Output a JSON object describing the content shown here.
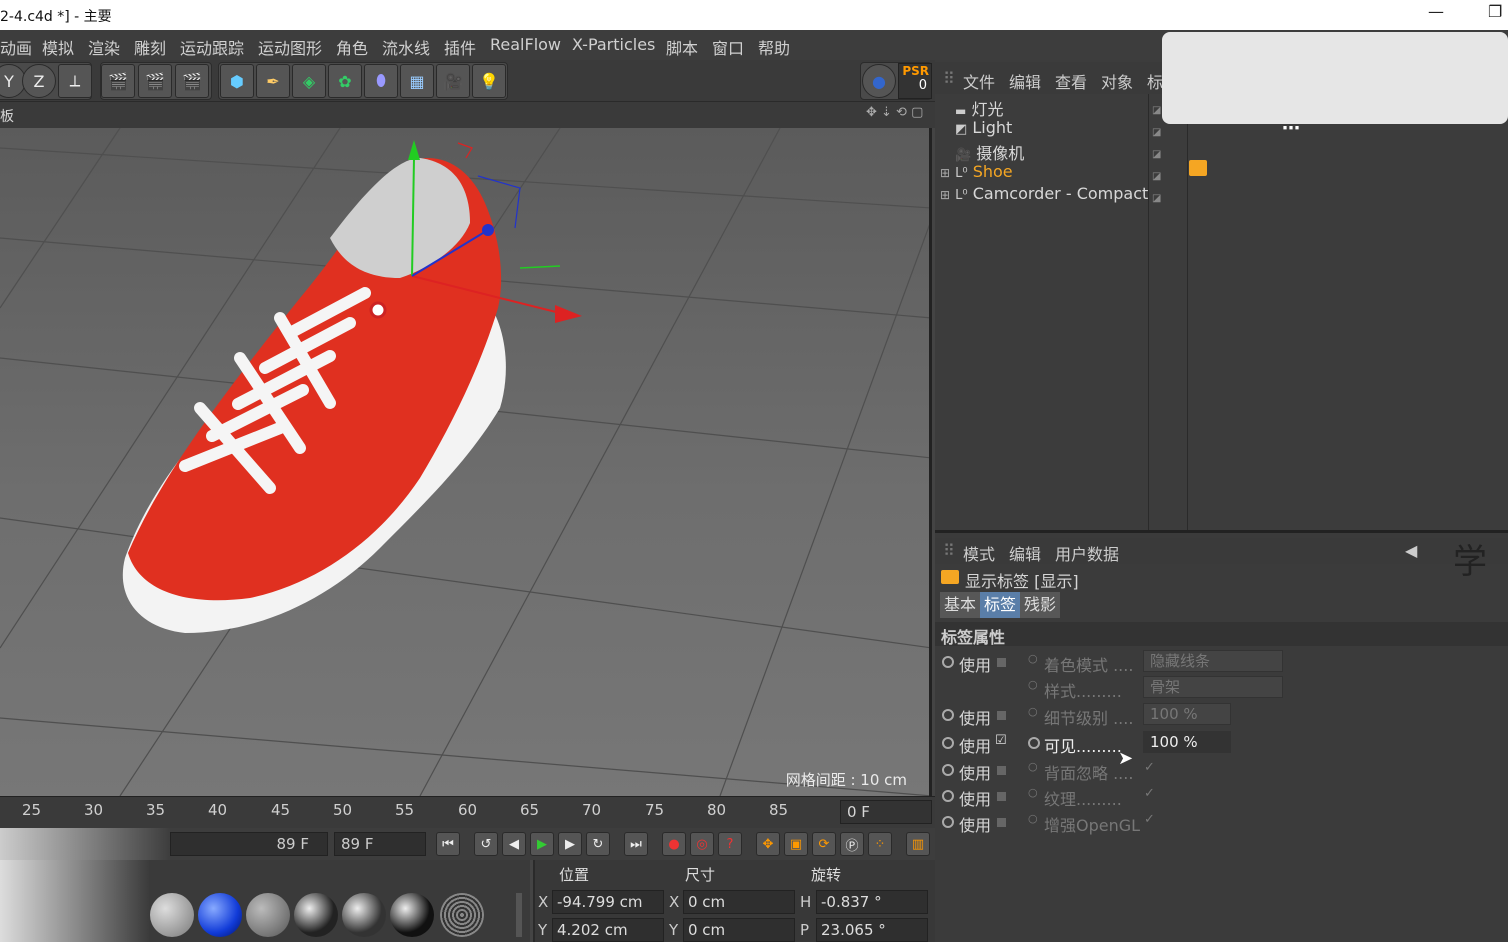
{
  "window": {
    "title": "2-4.c4d *] - 主要",
    "minimize": "—",
    "restore": "❐"
  },
  "menu": [
    "动画",
    "模拟",
    "渲染",
    "雕刻",
    "运动跟踪",
    "运动图形",
    "角色",
    "流水线",
    "插件",
    "RealFlow",
    "X-Particles",
    "脚本",
    "窗口",
    "帮助"
  ],
  "toolbar": {
    "y_label": "Y",
    "z_label": "Z",
    "psr": "PSR",
    "psr_value": "0"
  },
  "viewport": {
    "head_label": "板",
    "grid_spacing": "网格间距 : 10 cm"
  },
  "timeline": {
    "ticks": [
      "25",
      "30",
      "35",
      "40",
      "45",
      "50",
      "55",
      "60",
      "65",
      "70",
      "75",
      "80",
      "85"
    ],
    "frame": "0 F"
  },
  "transport": {
    "end_frame_a": "89 F",
    "end_frame_b": "89 F"
  },
  "coords": {
    "headers": {
      "position": "位置",
      "size": "尺寸",
      "rotation": "旋转"
    },
    "row1": {
      "axis": "X",
      "pos": "-94.799 cm",
      "size_axis": "X",
      "size": "0 cm",
      "rot_axis": "H",
      "rot": "-0.837 °"
    },
    "row2": {
      "axis": "Y",
      "pos": "4.202 cm",
      "size_axis": "Y",
      "size": "0 cm",
      "rot_axis": "P",
      "rot": "23.065 °"
    }
  },
  "object_manager": {
    "menu": [
      "文件",
      "编辑",
      "查看",
      "对象",
      "标"
    ],
    "objects": [
      {
        "name": "灯光",
        "highlight": false
      },
      {
        "name": "Light",
        "highlight": false
      },
      {
        "name": "摄像机",
        "highlight": false
      },
      {
        "name": "Shoe",
        "highlight": true
      },
      {
        "name": "Camcorder - Compact",
        "highlight": false
      }
    ]
  },
  "attr_manager": {
    "menu": [
      "模式",
      "编辑",
      "用户数据"
    ],
    "title": "显示标签 [显示]",
    "tabs": [
      "基本",
      "标签",
      "残影"
    ],
    "active_tab": "标签",
    "section": "标签属性",
    "use_label": "使用",
    "rows": [
      {
        "label": "着色模式 ....",
        "value": "隐藏线条"
      },
      {
        "label": "样式.........",
        "value": "骨架"
      },
      {
        "label": "细节级别 ....",
        "value": "100 %"
      },
      {
        "label": "可见.........",
        "value": "100 %"
      },
      {
        "label": "背面忽略 ....",
        "value": "✓"
      },
      {
        "label": "纹理.........",
        "value": "✓"
      },
      {
        "label": "增强OpenGL",
        "value": "✓"
      }
    ]
  },
  "watermark": "学"
}
